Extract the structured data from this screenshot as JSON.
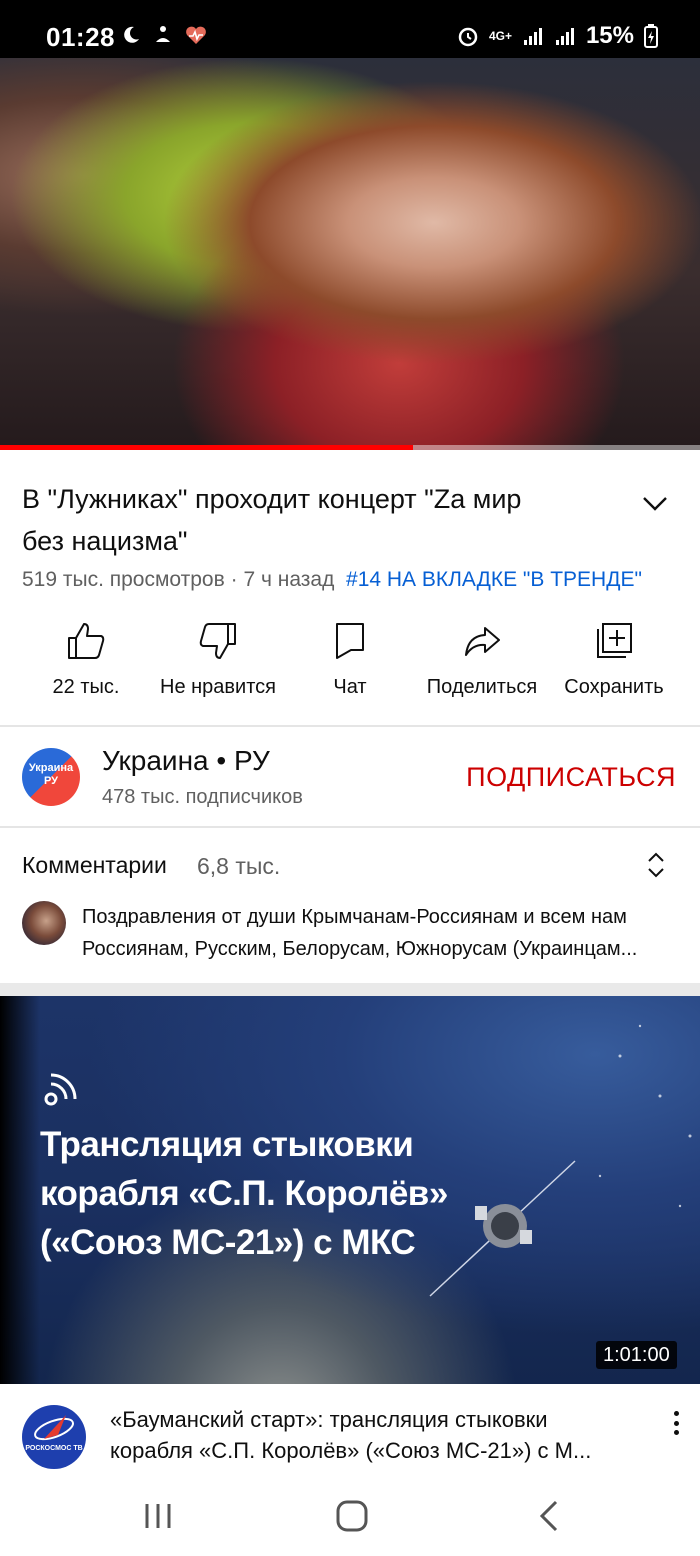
{
  "status_bar": {
    "time": "01:28",
    "network": "4G+",
    "battery": "15%"
  },
  "player": {
    "progress_fraction": 0.59,
    "accent": "#ff0000"
  },
  "video": {
    "title_line1": "В \"Лужниках\" проходит концерт \"Za мир",
    "title_line2": "без нацизма\"",
    "views": "519 тыс. просмотров",
    "separator": " · ",
    "age": "7 ч назад",
    "trending": "#14 НА ВКЛАДКЕ \"В ТРЕНДЕ\""
  },
  "actions": [
    {
      "label": "22 тыс.",
      "icon": "thumbs-up-icon"
    },
    {
      "label": "Не нравится",
      "icon": "thumbs-down-icon"
    },
    {
      "label": "Чат",
      "icon": "chat-icon"
    },
    {
      "label": "Поделиться",
      "icon": "share-icon"
    },
    {
      "label": "Сохранить",
      "icon": "save-playlist-icon"
    }
  ],
  "channel": {
    "avatar_text": "Украина РУ",
    "name": "Украина • РУ",
    "subscribers": "478 тыс. подписчиков",
    "subscribe_label": "ПОДПИСАТЬСЯ",
    "subscribe_color": "#cc0000"
  },
  "comments": {
    "heading": "Комментарии",
    "count": "6,8 тыс.",
    "preview_line1": "Поздравления от души Крымчанам-Россиянам и всем нам",
    "preview_line2": "Россиянам, Русским, Белорусам, Южнорусам (Украинцам..."
  },
  "next_video": {
    "thumb_title_line1": "Трансляция стыковки",
    "thumb_title_line2": "корабля «С.П. Королёв»",
    "thumb_title_line3": "(«Союз МС-21») с МКС",
    "duration": "1:01:00",
    "channel_avatar_text": "РОСКОСМОС ТВ",
    "title_line1": "«Бауманский старт»: трансляция стыковки",
    "title_line2": "корабля «С.П. Королёв» («Союз МС-21») с М..."
  }
}
